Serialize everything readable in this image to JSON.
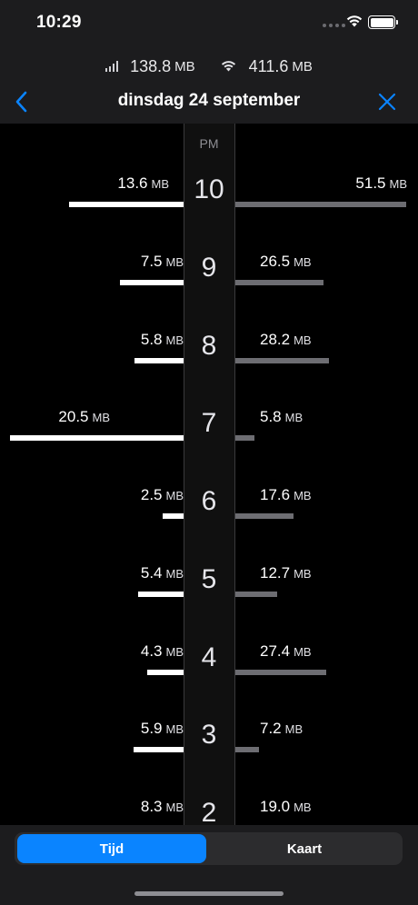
{
  "status_bar": {
    "time": "10:29"
  },
  "totals": {
    "cellular": {
      "value": "138.8",
      "unit": "MB",
      "icon": "cellular-icon"
    },
    "wifi": {
      "value": "411.6",
      "unit": "MB",
      "icon": "wifi-icon"
    }
  },
  "nav": {
    "title": "dinsdag 24 september",
    "back_icon": "chevron-left-icon",
    "close_icon": "close-icon"
  },
  "colors": {
    "accent": "#0a84ff",
    "left_bar": "#ffffff",
    "right_bar": "#6d6d72",
    "background": "#000000",
    "header": "#1c1c1e"
  },
  "chart": {
    "period_label": "PM",
    "unit": "MB",
    "rows": [
      {
        "hour": "10",
        "left": "13.6",
        "right": "51.5"
      },
      {
        "hour": "9",
        "left": "7.5",
        "right": "26.5"
      },
      {
        "hour": "8",
        "left": "5.8",
        "right": "28.2"
      },
      {
        "hour": "7",
        "left": "20.5",
        "right": "5.8"
      },
      {
        "hour": "6",
        "left": "2.5",
        "right": "17.6"
      },
      {
        "hour": "5",
        "left": "5.4",
        "right": "12.7"
      },
      {
        "hour": "4",
        "left": "4.3",
        "right": "27.4"
      },
      {
        "hour": "3",
        "left": "5.9",
        "right": "7.2"
      },
      {
        "hour": "2",
        "left": "8.3",
        "right": "19.0"
      }
    ]
  },
  "segmented": {
    "tabs": [
      {
        "label": "Tijd",
        "selected": true
      },
      {
        "label": "Kaart",
        "selected": false
      }
    ]
  }
}
